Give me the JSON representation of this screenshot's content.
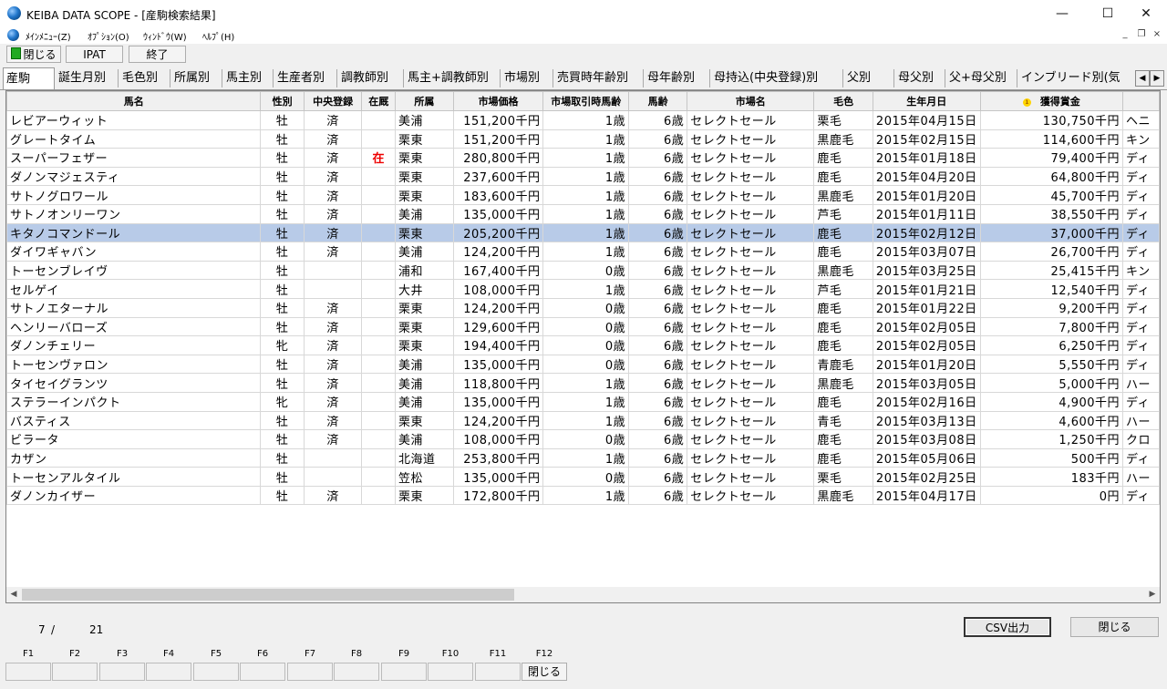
{
  "window": {
    "title": "KEIBA DATA SCOPE - [産駒検索結果]",
    "minimize": "—",
    "maximize": "☐",
    "close": "✕"
  },
  "menu": {
    "items": [
      "ﾒｲﾝﾒﾆｭｰ(Z)",
      "ｵﾌﾟｼｮﾝ(O)",
      "ｳｨﾝﾄﾞｳ(W)",
      "ﾍﾙﾌﾟ(H)"
    ],
    "mdi_minimize": "_",
    "mdi_restore": "❐",
    "mdi_close": "×"
  },
  "toolbar": {
    "close_label": "閉じる",
    "ipat_label": "IPAT",
    "exit_label": "終了"
  },
  "tabs": [
    "産駒",
    "誕生月別",
    "毛色別",
    "所属別",
    "馬主別",
    "生産者別",
    "調教師別",
    "馬主+調教師別",
    "市場別",
    "売買時年齢別",
    "母年齢別",
    "母持込(中央登録)別",
    "父別",
    "母父別",
    "父+母父別",
    "インブリード別(気"
  ],
  "tab_scroll": {
    "left": "◀",
    "right": "▶"
  },
  "table": {
    "columns": [
      "馬名",
      "性別",
      "中央登録",
      "在厩",
      "所属",
      "市場価格",
      "市場取引時馬齢",
      "馬齢",
      "市場名",
      "毛色",
      "生年月日",
      "獲得賞金",
      ""
    ],
    "sort_icon": "1",
    "rows": [
      [
        "レビアーウィット",
        "牡",
        "済",
        "",
        "美浦",
        "151,200千円",
        "1歳",
        "6歳",
        "セレクトセール",
        "栗毛",
        "2015年04月15日",
        "130,750千円",
        "ヘニ"
      ],
      [
        "グレートタイム",
        "牡",
        "済",
        "",
        "栗東",
        "151,200千円",
        "1歳",
        "6歳",
        "セレクトセール",
        "黒鹿毛",
        "2015年02月15日",
        "114,600千円",
        "キン"
      ],
      [
        "スーパーフェザー",
        "牡",
        "済",
        "在",
        "栗東",
        "280,800千円",
        "1歳",
        "6歳",
        "セレクトセール",
        "鹿毛",
        "2015年01月18日",
        "79,400千円",
        "ディ"
      ],
      [
        "ダノンマジェスティ",
        "牡",
        "済",
        "",
        "栗東",
        "237,600千円",
        "1歳",
        "6歳",
        "セレクトセール",
        "鹿毛",
        "2015年04月20日",
        "64,800千円",
        "ディ"
      ],
      [
        "サトノグロワール",
        "牡",
        "済",
        "",
        "栗東",
        "183,600千円",
        "1歳",
        "6歳",
        "セレクトセール",
        "黒鹿毛",
        "2015年01月20日",
        "45,700千円",
        "ディ"
      ],
      [
        "サトノオンリーワン",
        "牡",
        "済",
        "",
        "美浦",
        "135,000千円",
        "1歳",
        "6歳",
        "セレクトセール",
        "芦毛",
        "2015年01月11日",
        "38,550千円",
        "ディ"
      ],
      [
        "キタノコマンドール",
        "牡",
        "済",
        "",
        "栗東",
        "205,200千円",
        "1歳",
        "6歳",
        "セレクトセール",
        "鹿毛",
        "2015年02月12日",
        "37,000千円",
        "ディ"
      ],
      [
        "ダイワギャバン",
        "牡",
        "済",
        "",
        "美浦",
        "124,200千円",
        "1歳",
        "6歳",
        "セレクトセール",
        "鹿毛",
        "2015年03月07日",
        "26,700千円",
        "ディ"
      ],
      [
        "トーセンブレイヴ",
        "牡",
        "",
        "",
        "浦和",
        "167,400千円",
        "0歳",
        "6歳",
        "セレクトセール",
        "黒鹿毛",
        "2015年03月25日",
        "25,415千円",
        "キン"
      ],
      [
        "セルゲイ",
        "牡",
        "",
        "",
        "大井",
        "108,000千円",
        "1歳",
        "6歳",
        "セレクトセール",
        "芦毛",
        "2015年01月21日",
        "12,540千円",
        "ディ"
      ],
      [
        "サトノエターナル",
        "牡",
        "済",
        "",
        "栗東",
        "124,200千円",
        "0歳",
        "6歳",
        "セレクトセール",
        "鹿毛",
        "2015年01月22日",
        "9,200千円",
        "ディ"
      ],
      [
        "ヘンリーバローズ",
        "牡",
        "済",
        "",
        "栗東",
        "129,600千円",
        "0歳",
        "6歳",
        "セレクトセール",
        "鹿毛",
        "2015年02月05日",
        "7,800千円",
        "ディ"
      ],
      [
        "ダノンチェリー",
        "牝",
        "済",
        "",
        "栗東",
        "194,400千円",
        "0歳",
        "6歳",
        "セレクトセール",
        "鹿毛",
        "2015年02月05日",
        "6,250千円",
        "ディ"
      ],
      [
        "トーセンヴァロン",
        "牡",
        "済",
        "",
        "美浦",
        "135,000千円",
        "0歳",
        "6歳",
        "セレクトセール",
        "青鹿毛",
        "2015年01月20日",
        "5,550千円",
        "ディ"
      ],
      [
        "タイセイグランツ",
        "牡",
        "済",
        "",
        "美浦",
        "118,800千円",
        "1歳",
        "6歳",
        "セレクトセール",
        "黒鹿毛",
        "2015年03月05日",
        "5,000千円",
        "ハー"
      ],
      [
        "ステラーインパクト",
        "牝",
        "済",
        "",
        "美浦",
        "135,000千円",
        "1歳",
        "6歳",
        "セレクトセール",
        "鹿毛",
        "2015年02月16日",
        "4,900千円",
        "ディ"
      ],
      [
        "バスティス",
        "牡",
        "済",
        "",
        "栗東",
        "124,200千円",
        "1歳",
        "6歳",
        "セレクトセール",
        "青毛",
        "2015年03月13日",
        "4,600千円",
        "ハー"
      ],
      [
        "ビラータ",
        "牡",
        "済",
        "",
        "美浦",
        "108,000千円",
        "0歳",
        "6歳",
        "セレクトセール",
        "鹿毛",
        "2015年03月08日",
        "1,250千円",
        "クロ"
      ],
      [
        "カザン",
        "牡",
        "",
        "",
        "北海道",
        "253,800千円",
        "1歳",
        "6歳",
        "セレクトセール",
        "鹿毛",
        "2015年05月06日",
        "500千円",
        "ディ"
      ],
      [
        "トーセンアルタイル",
        "牡",
        "",
        "",
        "笠松",
        "135,000千円",
        "0歳",
        "6歳",
        "セレクトセール",
        "栗毛",
        "2015年02月25日",
        "183千円",
        "ハー"
      ],
      [
        "ダノンカイザー",
        "牡",
        "済",
        "",
        "栗東",
        "172,800千円",
        "1歳",
        "6歳",
        "セレクトセール",
        "黒鹿毛",
        "2015年04月17日",
        "0円",
        "ディ"
      ]
    ],
    "selected_row": 6
  },
  "scroll": {
    "left": "◀",
    "right": "▶"
  },
  "status": {
    "current": "7",
    "separator": "/",
    "total": "21"
  },
  "buttons": {
    "csv": "CSV出力",
    "close": "閉じる"
  },
  "fkeys": [
    {
      "key": "F1",
      "label": ""
    },
    {
      "key": "F2",
      "label": ""
    },
    {
      "key": "F3",
      "label": ""
    },
    {
      "key": "F4",
      "label": ""
    },
    {
      "key": "F5",
      "label": ""
    },
    {
      "key": "F6",
      "label": ""
    },
    {
      "key": "F7",
      "label": ""
    },
    {
      "key": "F8",
      "label": ""
    },
    {
      "key": "F9",
      "label": ""
    },
    {
      "key": "F10",
      "label": ""
    },
    {
      "key": "F11",
      "label": ""
    },
    {
      "key": "F12",
      "label": "閉じる"
    }
  ],
  "colors": {
    "selected_row": "#b8cbe8",
    "zai_mark": "#e00000",
    "window_bg": "#f0f0f0"
  }
}
